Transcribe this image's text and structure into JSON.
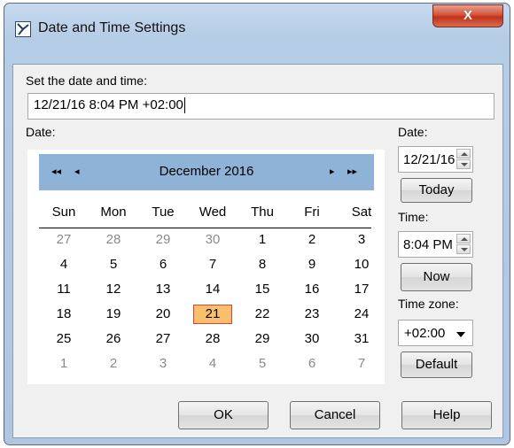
{
  "window": {
    "title": "Date and Time Settings",
    "close_label": "X"
  },
  "main": {
    "set_label": "Set the date and time:",
    "datetime_value": "12/21/16 8:04 PM +02:00",
    "date_section_label": "Date:"
  },
  "calendar": {
    "nav_prev_year": "◂◂",
    "nav_prev_month": "◂",
    "nav_next_month": "▸",
    "nav_next_year": "▸▸",
    "month_title": "December  2016",
    "weekdays": [
      "Sun",
      "Mon",
      "Tue",
      "Wed",
      "Thu",
      "Fri",
      "Sat"
    ],
    "days": [
      [
        "27",
        "28",
        "29",
        "30",
        "1",
        "2",
        "3"
      ],
      [
        "4",
        "5",
        "6",
        "7",
        "8",
        "9",
        "10"
      ],
      [
        "11",
        "12",
        "13",
        "14",
        "15",
        "16",
        "17"
      ],
      [
        "18",
        "19",
        "20",
        "21",
        "22",
        "23",
        "24"
      ],
      [
        "25",
        "26",
        "27",
        "28",
        "29",
        "30",
        "31"
      ],
      [
        "1",
        "2",
        "3",
        "4",
        "5",
        "6",
        "7"
      ]
    ],
    "selected_day": "21",
    "selected_color": "#f8c06c"
  },
  "side": {
    "date_label": "Date:",
    "date_value": "12/21/16",
    "today_label": "Today",
    "time_label": "Time:",
    "time_value": "8:04 PM",
    "now_label": "Now",
    "timezone_label": "Time zone:",
    "timezone_value": "+02:00",
    "default_label": "Default"
  },
  "footer": {
    "ok_label": "OK",
    "cancel_label": "Cancel",
    "help_label": "Help"
  }
}
